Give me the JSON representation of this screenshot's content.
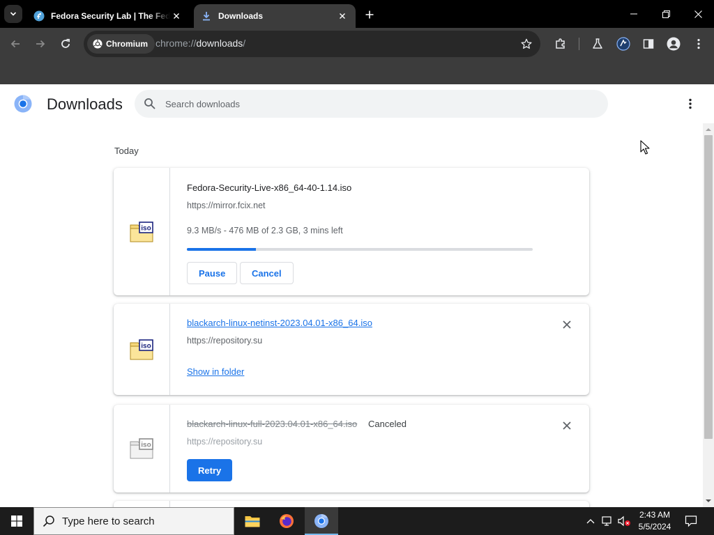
{
  "browser": {
    "tabs": [
      {
        "title": "Fedora Security Lab | The Fedora",
        "icon": "fedora-icon",
        "active": false
      },
      {
        "title": "Downloads",
        "icon": "download-icon",
        "active": true
      }
    ],
    "omnibox": {
      "chip_label": "Chromium",
      "url_scheme": "chrome://",
      "url_host": "downloads",
      "url_rest": "/"
    }
  },
  "page": {
    "title": "Downloads",
    "search_placeholder": "Search downloads",
    "section_label": "Today",
    "downloads": [
      {
        "filename": "Fedora-Security-Live-x86_64-40-1.14.iso",
        "source": "https://mirror.fcix.net",
        "progress_text": "9.3 MB/s - 476 MB of 2.3 GB, 3 mins left",
        "progress_fraction": 0.2,
        "pause_label": "Pause",
        "cancel_label": "Cancel",
        "file_icon": "iso-file-icon",
        "state": "in-progress"
      },
      {
        "filename": "blackarch-linux-netinst-2023.04.01-x86_64.iso",
        "source": "https://repository.su",
        "show_in_folder_label": "Show in folder",
        "file_icon": "iso-file-icon",
        "state": "complete"
      },
      {
        "filename": "blackarch-linux-full-2023.04.01-x86_64.iso",
        "status": "Canceled",
        "source": "https://repository.su",
        "retry_label": "Retry",
        "file_icon": "iso-file-icon",
        "state": "canceled"
      }
    ]
  },
  "taskbar": {
    "search_placeholder": "Type here to search",
    "time": "2:43 AM",
    "date": "5/5/2024"
  },
  "colors": {
    "accent": "#1a73e8",
    "browser_frame": "#000000",
    "toolbar": "#3c3c3c",
    "taskbar": "#1c1c1c"
  }
}
